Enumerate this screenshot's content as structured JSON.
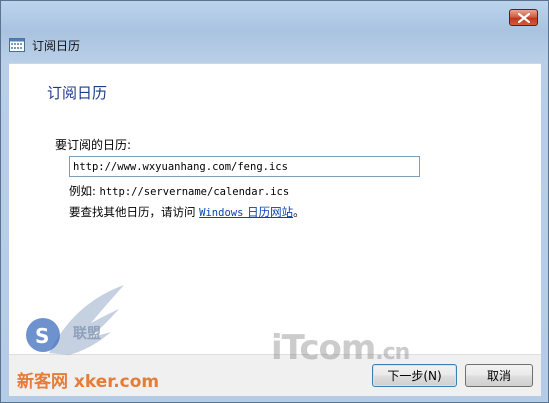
{
  "window": {
    "title": "订阅日历"
  },
  "page": {
    "heading": "订阅日历",
    "url_label": "要订阅的日历:",
    "url_value": "http://www.wxyuanhang.com/feng.ics",
    "example_prefix": "例如: ",
    "example_url": "http://servername/calendar.ics",
    "visit_prefix": "要查找其他日历，请访问 ",
    "visit_link_part1": "Windows",
    "visit_link_part2": " 日历网站",
    "visit_suffix": "。"
  },
  "buttons": {
    "next": "下一步(N)",
    "cancel": "取消"
  },
  "watermarks": {
    "left_text": "新客网 xker.com",
    "left_badge": "联盟",
    "right_text": "iTcom",
    "right_suffix": ".cn"
  },
  "icons": {
    "window_icon": "calendar-icon",
    "close": "close-icon"
  },
  "colors": {
    "heading": "#1e3c8c",
    "link": "#0645ad",
    "close_button": "#c0391f"
  }
}
